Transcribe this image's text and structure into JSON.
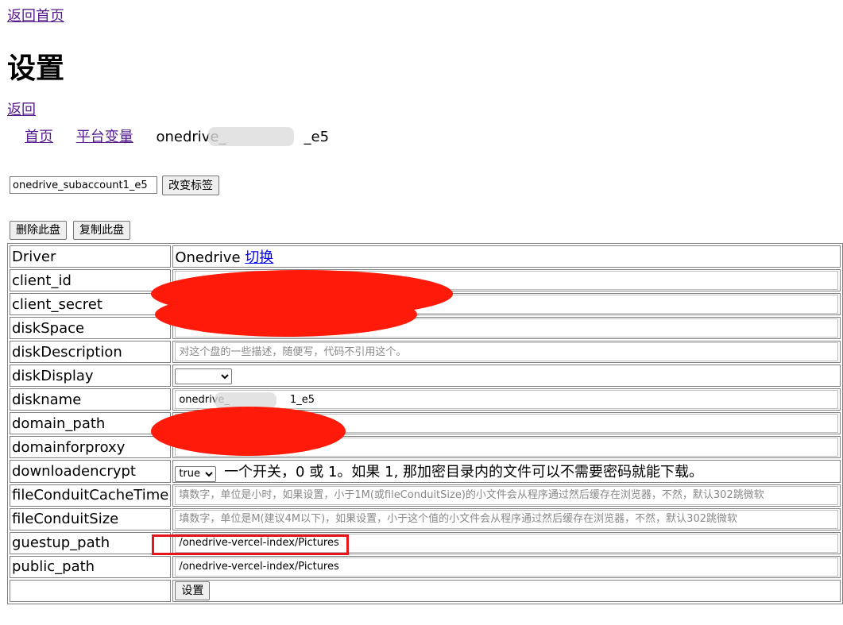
{
  "nav": {
    "home_link": "返回首页",
    "title": "设置",
    "back_link": "返回",
    "breadcrumb": [
      "首页",
      "平台变量"
    ],
    "current_disk_prefix": "onedrive_",
    "current_disk_suffix": "_e5"
  },
  "tag": {
    "input_value": "onedrive_subaccount1_e5",
    "change_button": "改变标签"
  },
  "actions": {
    "delete": "删除此盘",
    "copy": "复制此盘"
  },
  "table": {
    "rows": [
      {
        "label": "Driver",
        "value": "Onedrive",
        "link": "切换"
      },
      {
        "label": "client_id"
      },
      {
        "label": "client_secret"
      },
      {
        "label": "diskSpace"
      },
      {
        "label": "diskDescription",
        "placeholder": "对这个盘的一些描述，随便写，代码不引用这个。"
      },
      {
        "label": "diskDisplay",
        "value": ""
      },
      {
        "label": "diskname",
        "value": "onedrive_",
        "value_suffix": "1_e5"
      },
      {
        "label": "domain_path"
      },
      {
        "label": "domainforproxy"
      },
      {
        "label": "downloadencrypt",
        "value": "true",
        "hint": "一个开关，0 或 1。如果 1, 那加密目录内的文件可以不需要密码就能下载。"
      },
      {
        "label": "fileConduitCacheTime",
        "placeholder": "填数字，单位是小时，如果设置，小于1M(或fileConduitSize)的小文件会从程序通过然后缓存在浏览器，不然，默认302跳微软"
      },
      {
        "label": "fileConduitSize",
        "placeholder": "填数字，单位是M(建议4M以下)，如果设置，小于这个值的小文件会从程序通过然后缓存在浏览器，不然，默认302跳微软"
      },
      {
        "label": "guestup_path",
        "value": "/onedrive-vercel-index/Pictures"
      },
      {
        "label": "public_path",
        "value": "/onedrive-vercel-index/Pictures"
      }
    ],
    "submit": "设置"
  },
  "colors": {
    "link": "#551a8b",
    "switch_link": "#0000ee",
    "redaction": "#ff1a0a",
    "highlight": "#e8141b"
  }
}
